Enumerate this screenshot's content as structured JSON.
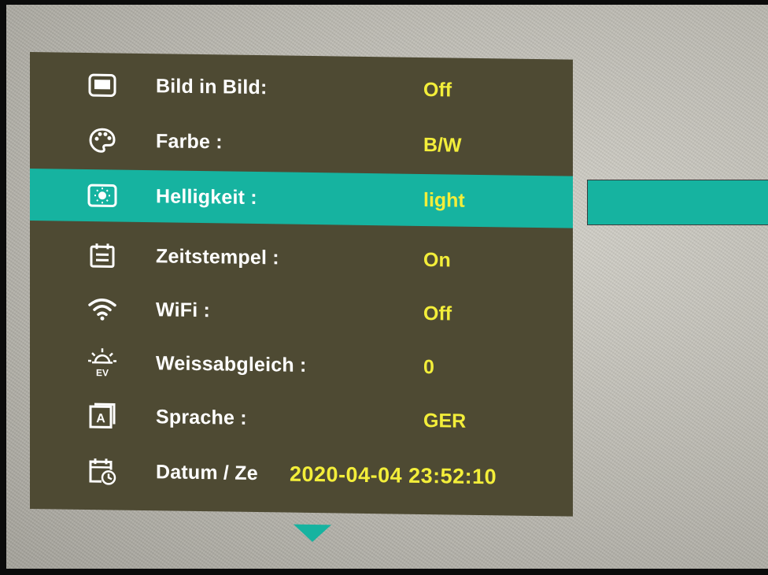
{
  "menu": {
    "items": [
      {
        "icon": "picture-in-picture-icon",
        "label": "Bild in Bild:",
        "value": "Off",
        "active": false
      },
      {
        "icon": "palette-icon",
        "label": "Farbe :",
        "value": "B/W",
        "active": false
      },
      {
        "icon": "brightness-icon",
        "label": "Helligkeit :",
        "value": "light",
        "active": true
      },
      {
        "icon": "timestamp-icon",
        "label": "Zeitstempel :",
        "value": "On",
        "active": false
      },
      {
        "icon": "wifi-icon",
        "label": "WiFi :",
        "value": "Off",
        "active": false
      },
      {
        "icon": "white-balance-icon",
        "label": "Weissabgleich :",
        "value": "0",
        "active": false
      },
      {
        "icon": "language-icon",
        "label": "Sprache :",
        "value": "GER",
        "active": false
      },
      {
        "icon": "date-time-icon",
        "label": "Datum / Ze",
        "value": "2020-04-04 23:52:10",
        "active": false
      }
    ]
  },
  "colors": {
    "menu_bg": "#4e4a33",
    "highlight": "#16b3a0",
    "value_text": "#f3ee3a",
    "label_text": "#ffffff"
  }
}
